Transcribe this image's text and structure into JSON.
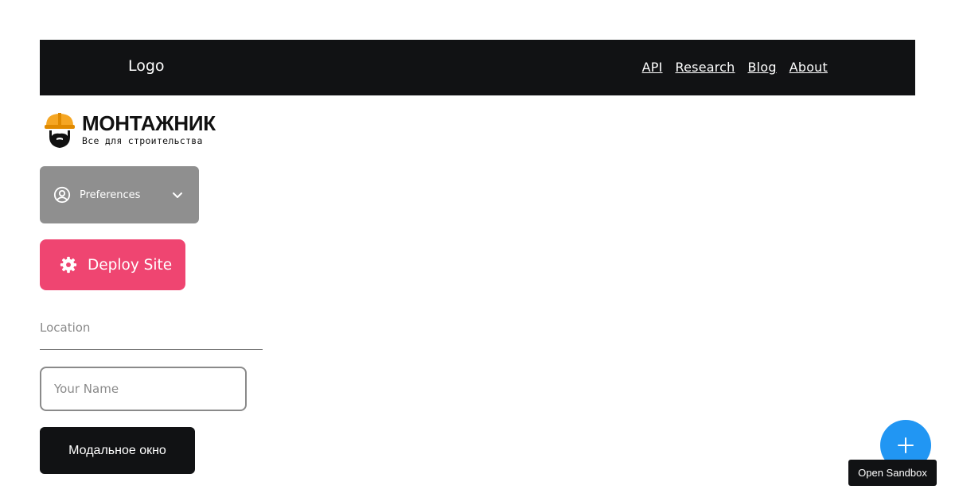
{
  "navbar": {
    "logo": "Logo",
    "links": [
      "API",
      "Research",
      "Blog",
      "About"
    ],
    "background": "#111214"
  },
  "brand": {
    "name": "МОНТАЖНИК",
    "tagline": "Все для строительства",
    "icon": "builder-hardhat-icon",
    "helmet_color": "#f5a623"
  },
  "preferences": {
    "label": "Preferences",
    "icon": "user-circle-icon",
    "chevron": "chevron-down-icon",
    "background": "#8f8f8f"
  },
  "deploy": {
    "label": "Deploy Site",
    "icon": "gear-icon",
    "background": "#ef4571"
  },
  "form": {
    "location_placeholder": "Location",
    "name_placeholder": "Your Name"
  },
  "modal_button": {
    "label": "Модальное окно"
  },
  "fab": {
    "icon": "plus-icon",
    "background": "#2196f3"
  },
  "tooltip": {
    "text": "Open Sandbox"
  }
}
